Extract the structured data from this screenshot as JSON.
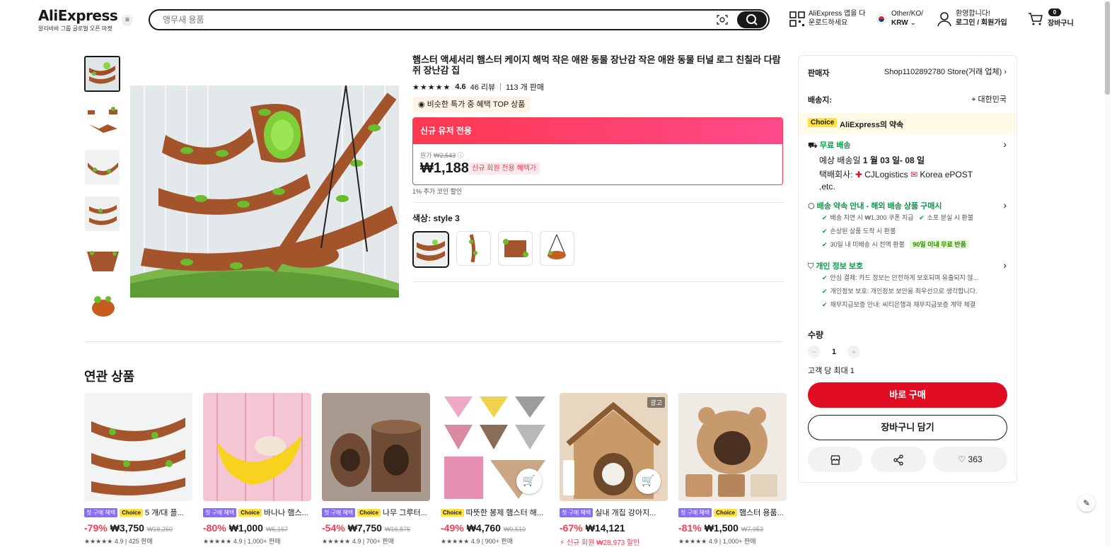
{
  "header": {
    "logo": "AliExpress",
    "logo_sub": "알리바바 그룹 글로벌 오픈 마켓",
    "search_placeholder": "앵무새 용품",
    "app_line1": "AliExpress 앱을 다",
    "app_line2": "운로드하세요",
    "region_line1": "Other/KO/",
    "region_line2": "KRW",
    "welcome": "환영합니다!",
    "login": "로그인 / 회원가입",
    "cart_count": "0",
    "cart_label": "장바구니"
  },
  "product": {
    "title": "햄스터 액세서리 햄스터 케이지 해먹 작은 애완 동물 장난감 작은 애완 동물 터널 로그 친칠라 다람쥐 장난감 집",
    "rating": "4.6",
    "reviews": "46 리뷰",
    "sold": "113 개 판매",
    "top_badge": "비슷한 특가 중 혜택 TOP 상품",
    "new_user_header": "신규 유저 전용",
    "orig_label": "원가",
    "orig_price": "₩2,543",
    "price": "₩1,188",
    "new_user_tag": "신규 회원 전용 혜택가",
    "coin_note": "1% 추가 코인 할인",
    "color_label": "색상",
    "color_value": "style 3"
  },
  "related": {
    "title": "연관 상품",
    "items": [
      {
        "tag_first": "첫 구매 혜택",
        "tag_choice": "Choice",
        "name": "5 개/대 플...",
        "pct": "-79%",
        "price": "₩3,750",
        "orig": "₩18,250",
        "rate": "4.9 | 425 판매"
      },
      {
        "tag_first": "첫 구매 혜택",
        "tag_choice": "Choice",
        "name": "바나나 햄스...",
        "pct": "-80%",
        "price": "₩1,000",
        "orig": "₩5,167",
        "rate": "4.9 | 1,000+ 판매"
      },
      {
        "tag_first": "첫 구매 혜택",
        "tag_choice": "Choice",
        "name": "나무 그루터...",
        "pct": "-54%",
        "price": "₩7,750",
        "orig": "₩16,875",
        "rate": "4.9 | 700+ 판매"
      },
      {
        "tag_first": "",
        "tag_choice": "Choice",
        "name": "따뜻한 봉제 햄스터 해...",
        "pct": "-49%",
        "price": "₩4,760",
        "orig": "₩9,510",
        "rate": "4.9 | 900+ 판매"
      },
      {
        "tag_first": "첫 구매 혜택",
        "tag_choice": "Choice",
        "name": "실내 개집 강아지...",
        "pct": "-67%",
        "price": "₩14,121",
        "orig": "",
        "rate": "",
        "coupon": "신규 회원 ₩28,973 할인",
        "ad": "광고"
      },
      {
        "tag_first": "첫 구매 혜택",
        "tag_choice": "Choice",
        "name": "햄스터 용품...",
        "pct": "-81%",
        "price": "₩1,500",
        "orig": "₩7,953",
        "rate": "4.9 | 1,000+ 판매"
      }
    ]
  },
  "panel": {
    "seller_label": "판매자",
    "seller_value": "Shop1102892780 Store(거래 업체)",
    "ship_label": "배송지:",
    "ship_value": "대한민국",
    "choice_tag": "Choice",
    "choice_text": "AliExpress의 약속",
    "free_ship": "무료 배송",
    "eta_prefix": "예상 배송일",
    "eta_value": "1 월 03 일- 08 일",
    "courier_label": "택배회사:",
    "courier1": "CJLogistics",
    "courier2": "Korea",
    "courier3": "ePOST ,etc.",
    "promise_title": "배송 약속 안내 - 해외 배송 상품 구매시",
    "promise1": "배송 지연 시 ₩1,300 쿠폰 지급",
    "promise2": "소포 분실 시 환불",
    "promise3": "손상된 상품 도착 시 환불",
    "promise4": "30일 내 미배송 시 전액 환불",
    "promise_tag": "90일 이내 무료 반품",
    "privacy_title": "개인 정보 보호",
    "privacy1": "안심 결제: 카드 정보는 안전하게 보호되며 유출되지 않...",
    "privacy2": "개인정보 보호: 개인정보 보안을 최우선으로 생각합니다.",
    "privacy3": "채무지급보증 안내: 씨티은행과 채무지급보증 계약 체결",
    "qty_label": "수량",
    "qty_value": "1",
    "qty_limit": "고객 당 최대 1",
    "buy_now": "바로 구매",
    "add_cart": "장바구니 담기",
    "wishlist_count": "363"
  }
}
